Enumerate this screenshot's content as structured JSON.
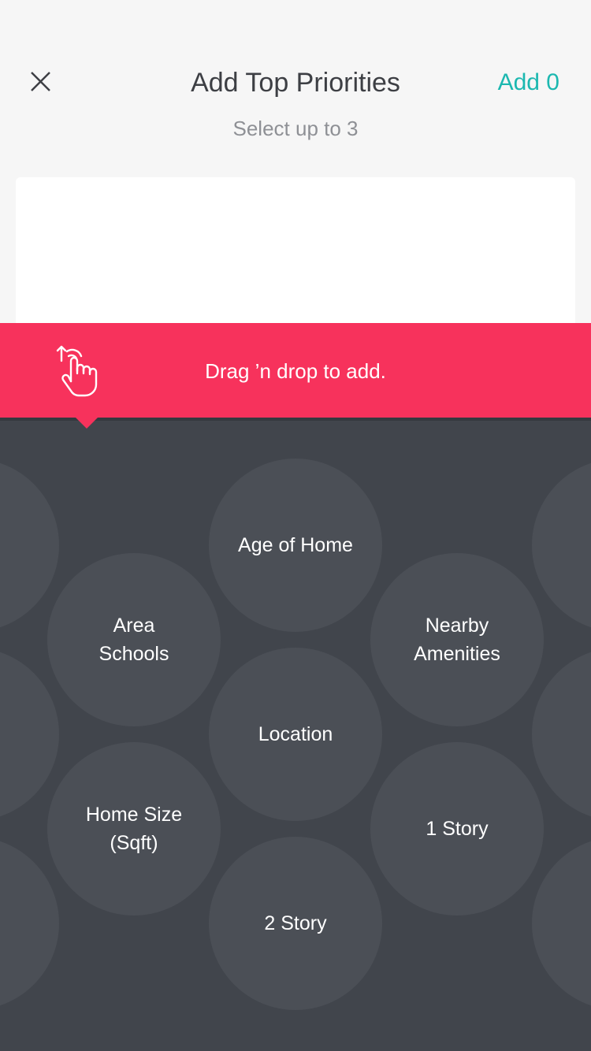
{
  "header": {
    "title": "Add Top Priorities",
    "subtitle": "Select up to 3",
    "add_label": "Add 0",
    "accent_color": "#1cb8b0"
  },
  "banner": {
    "text": "Drag ’n drop to add.",
    "color": "#f7325c",
    "icon": "hand-pointer-icon"
  },
  "priorities": [
    {
      "label": "Age of Home"
    },
    {
      "label": "Area\nSchools"
    },
    {
      "label": "Nearby\nAmenities"
    },
    {
      "label": "Location"
    },
    {
      "label": "Home Size\n(Sqft)"
    },
    {
      "label": "1 Story"
    },
    {
      "label": "2 Story"
    }
  ]
}
